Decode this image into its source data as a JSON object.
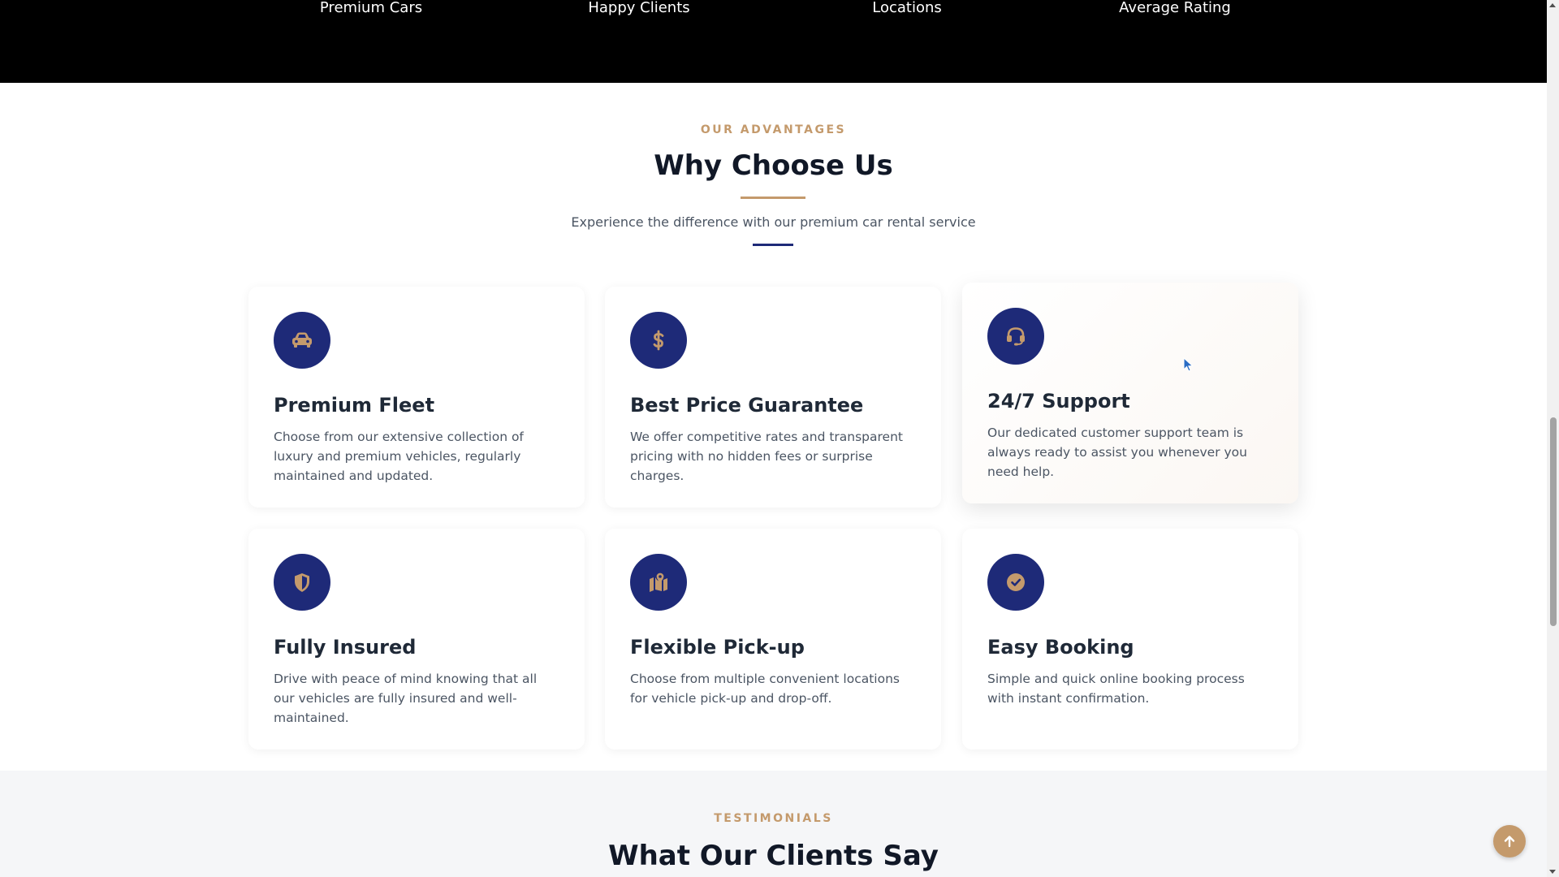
{
  "stats": {
    "labels": [
      "Premium Cars",
      "Happy Clients",
      "Locations",
      "Average Rating"
    ]
  },
  "advantages": {
    "eyebrow": "OUR ADVANTAGES",
    "title": "Why Choose Us",
    "subtitle": "Experience the difference with our premium car rental service",
    "cards": [
      {
        "icon": "car-icon",
        "title": "Premium Fleet",
        "text": "Choose from our extensive collection of luxury and premium vehicles, regularly maintained and updated."
      },
      {
        "icon": "dollar-icon",
        "title": "Best Price Guarantee",
        "text": "We offer competitive rates and transparent pricing with no hidden fees or surprise charges."
      },
      {
        "icon": "headset-icon",
        "title": "24/7 Support",
        "text": "Our dedicated customer support team is always ready to assist you whenever you need help."
      },
      {
        "icon": "shield-icon",
        "title": "Fully Insured",
        "text": "Drive with peace of mind knowing that all our vehicles are fully insured and well-maintained."
      },
      {
        "icon": "map-marker-icon",
        "title": "Flexible Pick-up",
        "text": "Choose from multiple convenient locations for vehicle pick-up and drop-off."
      },
      {
        "icon": "check-circle-icon",
        "title": "Easy Booking",
        "text": "Simple and quick online booking process with instant confirmation."
      }
    ]
  },
  "testimonials": {
    "eyebrow": "TESTIMONIALS",
    "title": "What Our Clients Say"
  },
  "colors": {
    "brand_navy": "#1e2a78",
    "accent_gold": "#c49a6c",
    "stats_background": "#000000"
  }
}
